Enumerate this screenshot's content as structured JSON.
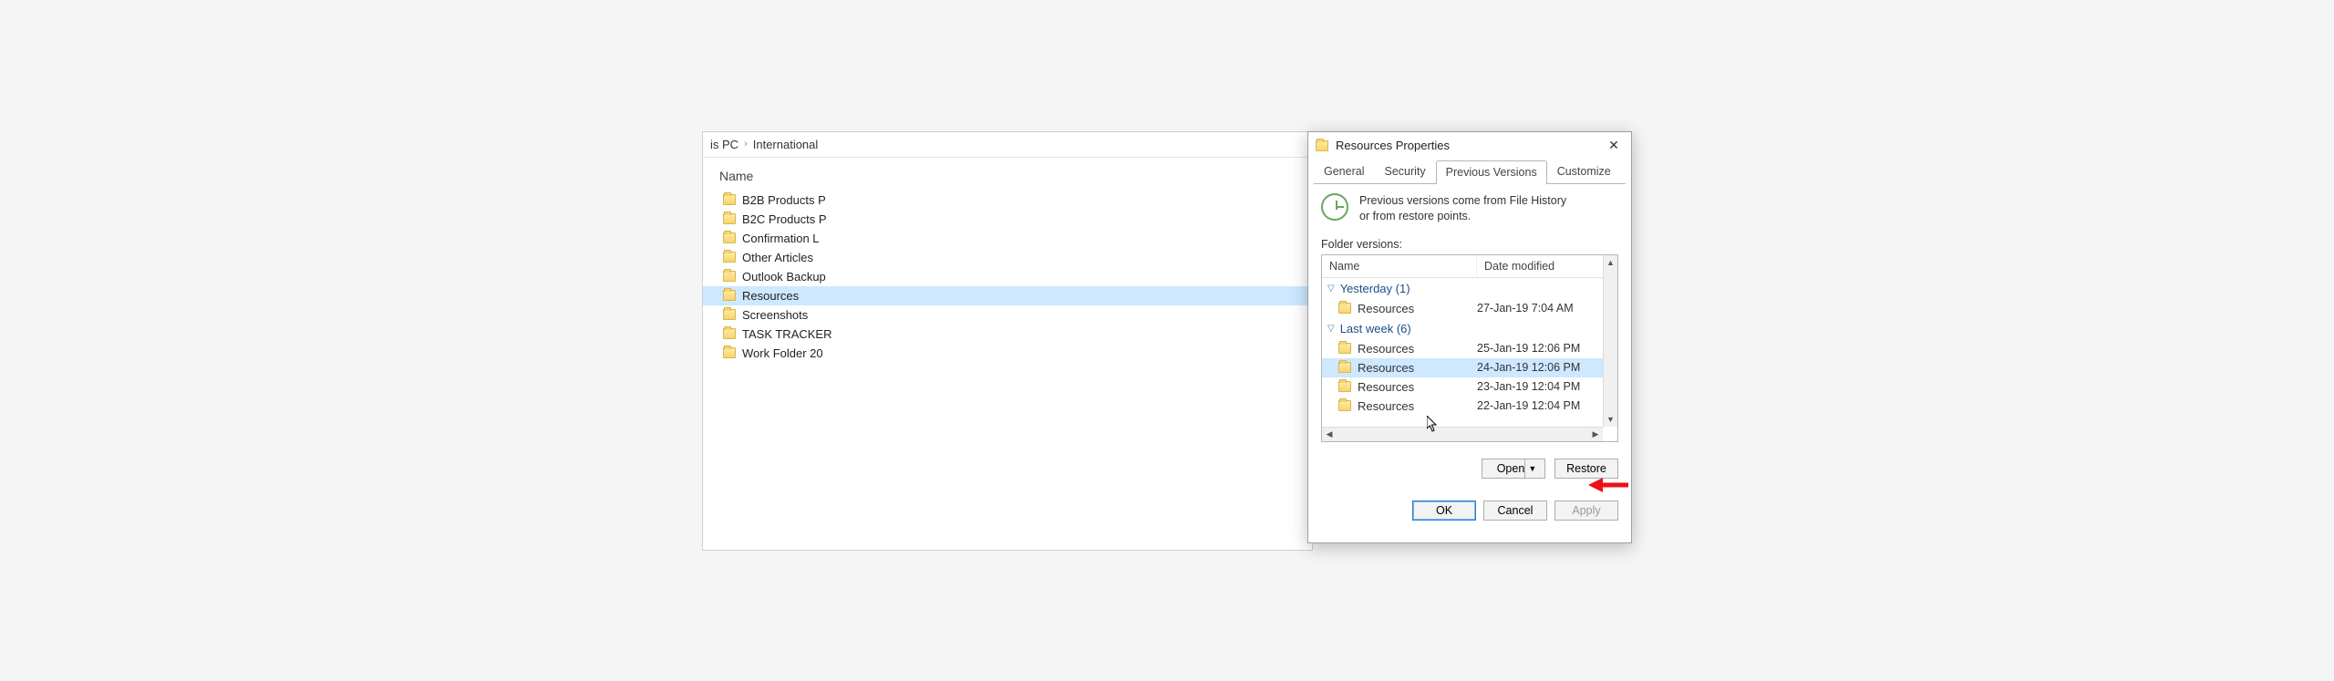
{
  "explorer": {
    "breadcrumb": {
      "a": "is PC",
      "b": "International"
    },
    "name_header": "Name",
    "items": [
      "B2B Products P",
      "B2C Products P",
      "Confirmation L",
      "Other Articles",
      "Outlook Backup",
      "Resources",
      "Screenshots",
      "TASK TRACKER",
      "Work Folder 20"
    ],
    "selected_index": 5
  },
  "dialog": {
    "title": "Resources Properties",
    "tabs": {
      "general": "General",
      "security": "Security",
      "previous": "Previous Versions",
      "customize": "Customize"
    },
    "active_tab": "previous",
    "info_text": "Previous versions come from File History or from restore points.",
    "folder_versions_label": "Folder versions:",
    "columns": {
      "name": "Name",
      "date": "Date modified"
    },
    "groups": [
      {
        "title": "Yesterday (1)",
        "items": [
          {
            "name": "Resources",
            "date": "27-Jan-19 7:04 AM"
          }
        ]
      },
      {
        "title": "Last week (6)",
        "items": [
          {
            "name": "Resources",
            "date": "25-Jan-19 12:06 PM"
          },
          {
            "name": "Resources",
            "date": "24-Jan-19 12:06 PM"
          },
          {
            "name": "Resources",
            "date": "23-Jan-19 12:04 PM"
          },
          {
            "name": "Resources",
            "date": "22-Jan-19 12:04 PM"
          }
        ]
      }
    ],
    "selected": {
      "group": 1,
      "item": 1
    },
    "buttons": {
      "open": "Open",
      "restore": "Restore",
      "ok": "OK",
      "cancel": "Cancel",
      "apply": "Apply"
    }
  }
}
